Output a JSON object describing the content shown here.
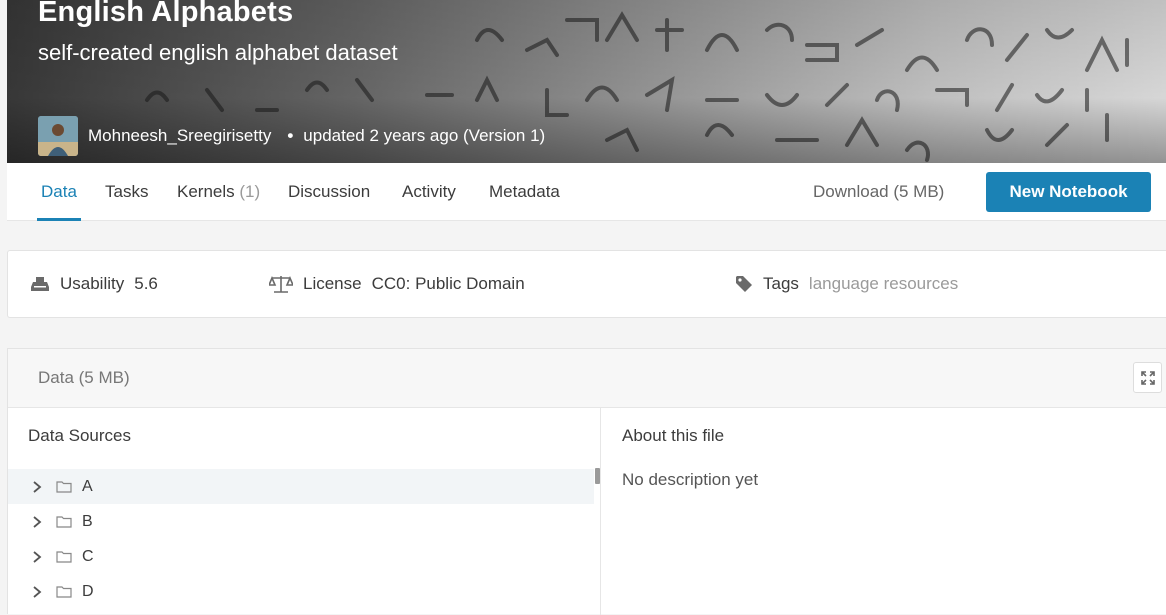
{
  "hero": {
    "title": "English Alphabets",
    "subtitle": "self-created english alphabet dataset",
    "author": "Mohneesh_Sreegirisetty",
    "separator": "•",
    "updated": "updated 2 years ago (Version 1)"
  },
  "tabs": [
    {
      "label": "Data",
      "active": true
    },
    {
      "label": "Tasks"
    },
    {
      "label": "Kernels",
      "count": "(1)"
    },
    {
      "label": "Discussion"
    },
    {
      "label": "Activity"
    },
    {
      "label": "Metadata"
    }
  ],
  "actions": {
    "download": "Download (5 MB)",
    "new_notebook": "New Notebook"
  },
  "info": {
    "usability_label": "Usability",
    "usability_value": "5.6",
    "license_label": "License",
    "license_value": "CC0: Public Domain",
    "tags_label": "Tags",
    "tags_value": "language resources"
  },
  "data_panel": {
    "title": "Data (5 MB)",
    "sources_title": "Data Sources",
    "folders": [
      "A",
      "B",
      "C",
      "D"
    ],
    "about_title": "About this file",
    "about_desc": "No description yet"
  },
  "colors": {
    "accent": "#1b82b5",
    "text": "#3c3c3c",
    "muted": "#9a9a9a"
  },
  "icons": [
    "chevron-right-icon",
    "folder-icon",
    "dashboard-icon",
    "scale-icon",
    "tag-icon",
    "expand-icon"
  ]
}
